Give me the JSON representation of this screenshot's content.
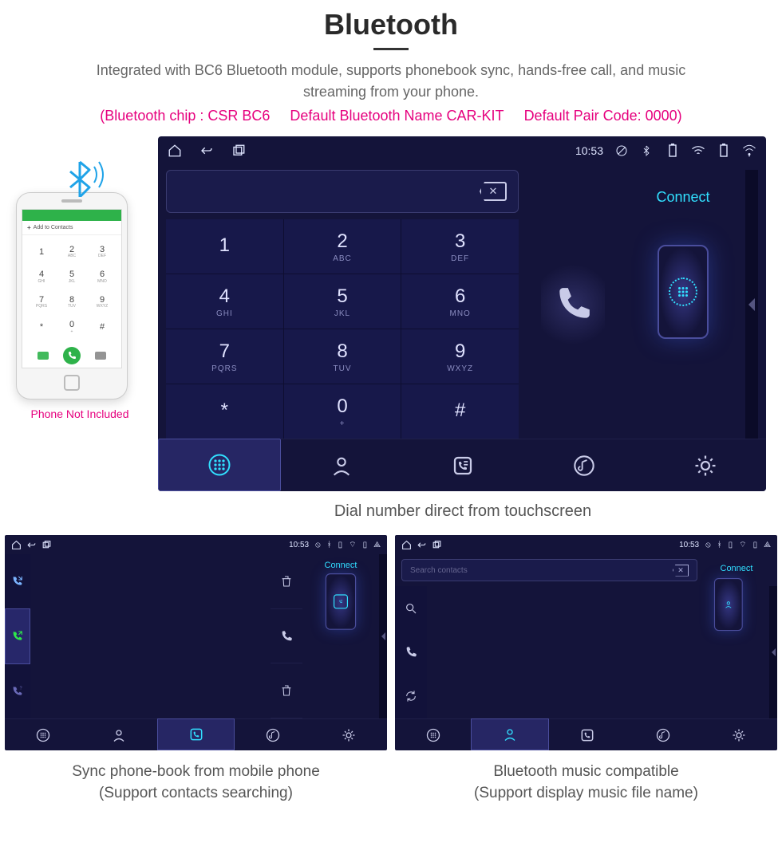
{
  "header": {
    "title": "Bluetooth",
    "desc": "Integrated with BC6 Bluetooth module, supports phonebook sync, hands-free call, and music streaming from your phone.",
    "spec1": "(Bluetooth chip : CSR BC6",
    "spec2": "Default Bluetooth Name CAR-KIT",
    "spec3": "Default Pair Code: 0000)"
  },
  "phone": {
    "add_contacts": "Add to Contacts",
    "not_included": "Phone Not Included"
  },
  "status": {
    "time": "10:53"
  },
  "connect": {
    "label": "Connect"
  },
  "keypad": [
    {
      "num": "1",
      "let": ""
    },
    {
      "num": "2",
      "let": "ABC"
    },
    {
      "num": "3",
      "let": "DEF"
    },
    {
      "num": "4",
      "let": "GHI"
    },
    {
      "num": "5",
      "let": "JKL"
    },
    {
      "num": "6",
      "let": "MNO"
    },
    {
      "num": "7",
      "let": "PQRS"
    },
    {
      "num": "8",
      "let": "TUV"
    },
    {
      "num": "9",
      "let": "WXYZ"
    },
    {
      "num": "*",
      "let": ""
    },
    {
      "num": "0",
      "let": "+"
    },
    {
      "num": "#",
      "let": ""
    }
  ],
  "captions": {
    "main": "Dial number direct from touchscreen",
    "left1": "Sync phone-book from mobile phone",
    "left2": "(Support contacts searching)",
    "right1": "Bluetooth music compatible",
    "right2": "(Support display music file name)"
  },
  "search": {
    "placeholder": "Search contacts"
  }
}
